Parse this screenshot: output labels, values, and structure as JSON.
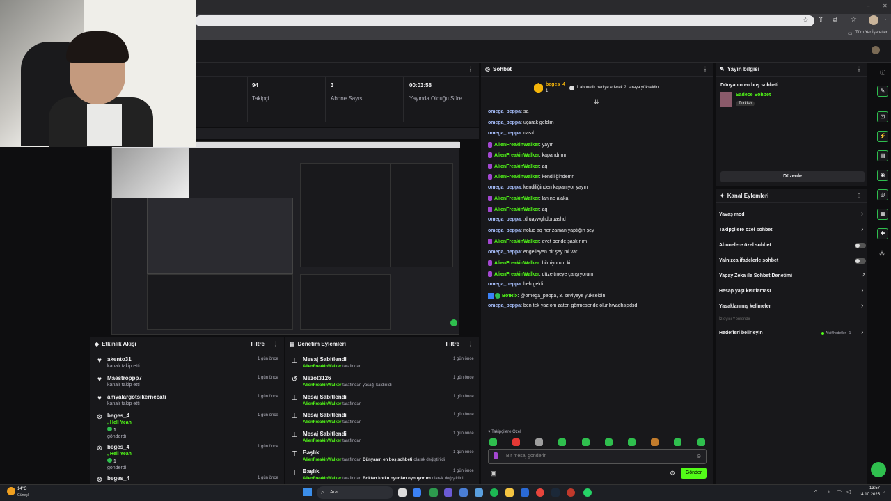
{
  "stats": [
    {
      "value": "94",
      "label": "Takipçi"
    },
    {
      "value": "3",
      "label": "Abone Sayısı"
    },
    {
      "value": "00:03:58",
      "label": "Yayında Olduğu Süre"
    }
  ],
  "chat": {
    "title": "Sohbet",
    "pinned_user": "beges_4",
    "pinned_count": "1",
    "pinned_text": "1 abonelik hediye ederek 2. sıraya yükseldin",
    "messages": [
      {
        "user": "omega_peppa",
        "text": "sa",
        "type": "omega"
      },
      {
        "user": "omega_peppa",
        "text": "uçarak geldim",
        "type": "omega"
      },
      {
        "user": "omega_peppa",
        "text": "nasıl",
        "type": "omega"
      },
      {
        "user": "AlienFreakinWalker",
        "text": "yayın",
        "type": "alien"
      },
      {
        "user": "AlienFreakinWalker",
        "text": "kapandı mı",
        "type": "alien"
      },
      {
        "user": "AlienFreakinWalker",
        "text": "aq",
        "type": "alien"
      },
      {
        "user": "AlienFreakinWalker",
        "text": "kendiliğindemn",
        "type": "alien"
      },
      {
        "user": "omega_peppa",
        "text": "kendiliğinden kapanıyor yayın",
        "type": "omega"
      },
      {
        "user": "AlienFreakinWalker",
        "text": "lan ne alaka",
        "type": "alien"
      },
      {
        "user": "AlienFreakinWalker",
        "text": "aq",
        "type": "alien"
      },
      {
        "user": "omega_peppa",
        "text": ".d uaywghdoıuashd",
        "type": "omega"
      },
      {
        "user": "omega_peppa",
        "text": "noluo aq her zaman yaptığın şey",
        "type": "omega"
      },
      {
        "user": "AlienFreakinWalker",
        "text": "evet bende şaşkınım",
        "type": "alien"
      },
      {
        "user": "omega_peppa",
        "text": "engelleyen bir şey mi var",
        "type": "omega"
      },
      {
        "user": "AlienFreakinWalker",
        "text": "bilmiyorum ki",
        "type": "alien"
      },
      {
        "user": "AlienFreakinWalker",
        "text": "düzeltmeye çalışıyorum",
        "type": "alien"
      },
      {
        "user": "omega_peppa",
        "text": "heh geldi",
        "type": "omega"
      },
      {
        "user": "BotRix",
        "text": "@omega_peppa, 3. seviyeye yükseldin",
        "type": "bot"
      },
      {
        "user": "omega_peppa",
        "text": "ben tek yazıom zaten görmesende olur hwadhsjsdsd",
        "type": "omega"
      }
    ],
    "followers_only": "Takipçilere Özel",
    "input_placeholder": "Bir mesaj gönderin",
    "send_label": "Gönder"
  },
  "stream_info": {
    "title": "Yayın bilgisi",
    "stream_title": "Dünyanın en boş sohbeti",
    "category": "Sadece Sohbet",
    "tag": "Turkish",
    "edit_label": "Düzenle"
  },
  "channel_actions": {
    "title": "Kanal Eylemleri",
    "items": [
      {
        "label": "Yavaş mod",
        "control": "chevron"
      },
      {
        "label": "Takipçilere özel sohbet",
        "control": "chevron"
      },
      {
        "label": "Abonelere özel sohbet",
        "control": "toggle"
      },
      {
        "label": "Yalnızca ifadelerle sohbet",
        "control": "toggle"
      },
      {
        "label": "Yapay Zeka ile Sohbet Denetimi",
        "control": "external"
      },
      {
        "label": "Hesap yaşı kısıtlaması",
        "control": "chevron"
      },
      {
        "label": "Yasaklanmış kelimeler",
        "control": "chevron"
      }
    ],
    "viewer_redirect": "İzleyici Yönlendir",
    "goals_label": "Hedefleri belirleyin",
    "goals_status": "Aktif hedefler - 1"
  },
  "activity": {
    "title": "Etkinlik Akışı",
    "filter": "Filtre",
    "items": [
      {
        "user": "akento31",
        "sub": "kanalı takip etti",
        "ago": "1 gün önce",
        "kind": "follow"
      },
      {
        "user": "Maestroppp7",
        "sub": "kanalı takip etti",
        "ago": "1 gün önce",
        "kind": "follow"
      },
      {
        "user": "amyalargotsikernecati",
        "sub": "kanalı takip etti",
        "ago": "1 gün önce",
        "kind": "follow"
      },
      {
        "user": "beges_4",
        "extra": ", Hell Yeah",
        "count": "1",
        "sub": "gönderdi",
        "ago": "1 gün önce",
        "kind": "gift"
      },
      {
        "user": "beges_4",
        "extra": ", Hell Yeah",
        "count": "1",
        "sub": "gönderdi",
        "ago": "1 gün önce",
        "kind": "gift"
      },
      {
        "user": "beges_4",
        "ago": "1 gün önce",
        "kind": "gift"
      }
    ]
  },
  "mod": {
    "title": "Denetim Eylemleri",
    "filter": "Filtre",
    "items": [
      {
        "title": "Mesaj Sabitlendi",
        "user": "AlienFreakinWalker",
        "sub": "tarafından",
        "ago": "1 gün önce",
        "icon": "pin"
      },
      {
        "title": "Mezot3126",
        "user": "AlienFreakinWalker",
        "sub": "tarafından yasağı kaldırıldı",
        "ago": "1 gün önce",
        "icon": "undo"
      },
      {
        "title": "Mesaj Sabitlendi",
        "user": "AlienFreakinWalker",
        "sub": "tarafından",
        "ago": "1 gün önce",
        "icon": "pin"
      },
      {
        "title": "Mesaj Sabitlendi",
        "user": "AlienFreakinWalker",
        "sub": "tarafından",
        "ago": "1 gün önce",
        "icon": "pin"
      },
      {
        "title": "Mesaj Sabitlendi",
        "user": "AlienFreakinWalker",
        "sub": "tarafından",
        "ago": "1 gün önce",
        "icon": "pin"
      },
      {
        "title": "Başlık",
        "user": "AlienFreakinWalker",
        "sub": "tarafından",
        "highlight": "Dünyanın en boş sohbeti",
        "tail": "olarak değiştirildi",
        "ago": "1 gün önce",
        "icon": "text"
      },
      {
        "title": "Başlık",
        "user": "AlienFreakinWalker",
        "sub": "tarafından",
        "highlight": "Boktan korku oyunları oynuyorum",
        "tail": "olarak değiştirildi",
        "ago": "1 gün önce",
        "icon": "text"
      }
    ]
  },
  "browser": {
    "bookmarks": "Tüm Yer İşaretleri"
  },
  "taskbar": {
    "weather_temp": "14°C",
    "weather_desc": "Güneşli",
    "search": "Ara",
    "time": "13:57",
    "date": "14.10.2025"
  },
  "colors": {
    "accent": "#53fc18",
    "alien": "#53fc18",
    "omega": "#a9c1ff",
    "bg": "#0e0e10",
    "panel": "#18181b"
  }
}
